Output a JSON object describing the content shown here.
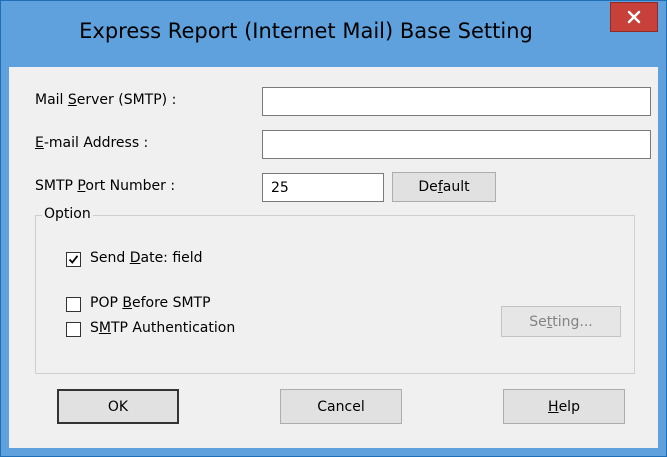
{
  "window": {
    "title": "Express Report (Internet Mail) Base Setting",
    "close_glyph": "x"
  },
  "fields": {
    "mail_server": {
      "label_pre": "Mail ",
      "label_u": "S",
      "label_post": "erver (SMTP) :",
      "value": ""
    },
    "email": {
      "label_pre": "",
      "label_u": "E",
      "label_post": "-mail Address :",
      "value": ""
    },
    "port": {
      "label_pre": "SMTP ",
      "label_u": "P",
      "label_post": "ort Number :",
      "value": "25"
    }
  },
  "default_button": {
    "pre": "De",
    "u": "f",
    "post": "ault"
  },
  "option_group": {
    "legend": "Option",
    "send_date": {
      "pre": "Send ",
      "u": "D",
      "post": "ate: field",
      "checked": true
    },
    "pop_before_smtp": {
      "pre": "POP ",
      "u": "B",
      "post": "efore SMTP",
      "checked": false
    },
    "smtp_auth": {
      "pre": "S",
      "u": "M",
      "post": "TP Authentication",
      "checked": false
    },
    "setting_button": {
      "pre": "Se",
      "u": "t",
      "post": "ting...",
      "enabled": false
    }
  },
  "buttons": {
    "ok": "OK",
    "cancel": "Cancel",
    "help": {
      "u": "H",
      "post": "elp"
    }
  },
  "icons": {
    "close": "close-icon",
    "check": "checkmark-icon"
  },
  "colors": {
    "titlebar": "#5ea1dd",
    "close_button": "#c7413a",
    "dialog_bg": "#f0f0f0"
  }
}
